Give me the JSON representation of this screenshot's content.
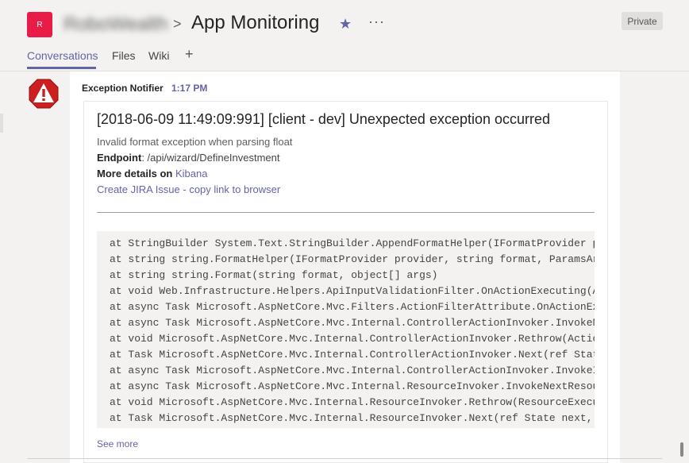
{
  "header": {
    "team_avatar_letter": "R",
    "team_name": "RoboWealth",
    "breadcrumb_separator": ">",
    "channel_title": "App Monitoring",
    "favorite_icon": "star-icon",
    "more_icon": "more-icon",
    "more_label": "···",
    "private_label": "Private",
    "accent_color": "#6264a7",
    "team_color": "#e81c47"
  },
  "tabs": {
    "items": [
      {
        "label": "Conversations",
        "active": true
      },
      {
        "label": "Files",
        "active": false
      },
      {
        "label": "Wiki",
        "active": false
      }
    ],
    "add_label": "+"
  },
  "message": {
    "sender": "Exception Notifier",
    "time": "1:17 PM",
    "avatar_icon": "warning-icon",
    "card": {
      "title": "[2018-06-09 11:49:09:991] [client - dev] Unexpected exception occurred",
      "description": "Invalid format exception when parsing float",
      "endpoint_label": "Endpoint",
      "endpoint_value": ": /api/wizard/DefineInvestment",
      "details_label": "More details on",
      "details_link": "Kibana",
      "jira_link": "Create JIRA Issue - copy link to browser",
      "stack_trace": [
        "at StringBuilder System.Text.StringBuilder.AppendFormatHelper(IFormatProvider pr",
        "at string string.FormatHelper(IFormatProvider provider, string format, ParamsArr",
        "at string string.Format(string format, object[] args)",
        "at void Web.Infrastructure.Helpers.ApiInputValidationFilter.OnActionExecuting(Ac",
        "at async Task Microsoft.AspNetCore.Mvc.Filters.ActionFilterAttribute.OnActionExe",
        "at async Task Microsoft.AspNetCore.Mvc.Internal.ControllerActionInvoker.InvokeNe",
        "at void Microsoft.AspNetCore.Mvc.Internal.ControllerActionInvoker.Rethrow(Action",
        "at Task Microsoft.AspNetCore.Mvc.Internal.ControllerActionInvoker.Next(ref State",
        "at async Task Microsoft.AspNetCore.Mvc.Internal.ControllerActionInvoker.InvokeIn",
        "at async Task Microsoft.AspNetCore.Mvc.Internal.ResourceInvoker.InvokeNextResour",
        "at void Microsoft.AspNetCore.Mvc.Internal.ResourceInvoker.Rethrow(ResourceExecut",
        "at Task Microsoft.AspNetCore.Mvc.Internal.ResourceInvoker.Next(ref State next, r"
      ],
      "see_more": "See more"
    }
  }
}
